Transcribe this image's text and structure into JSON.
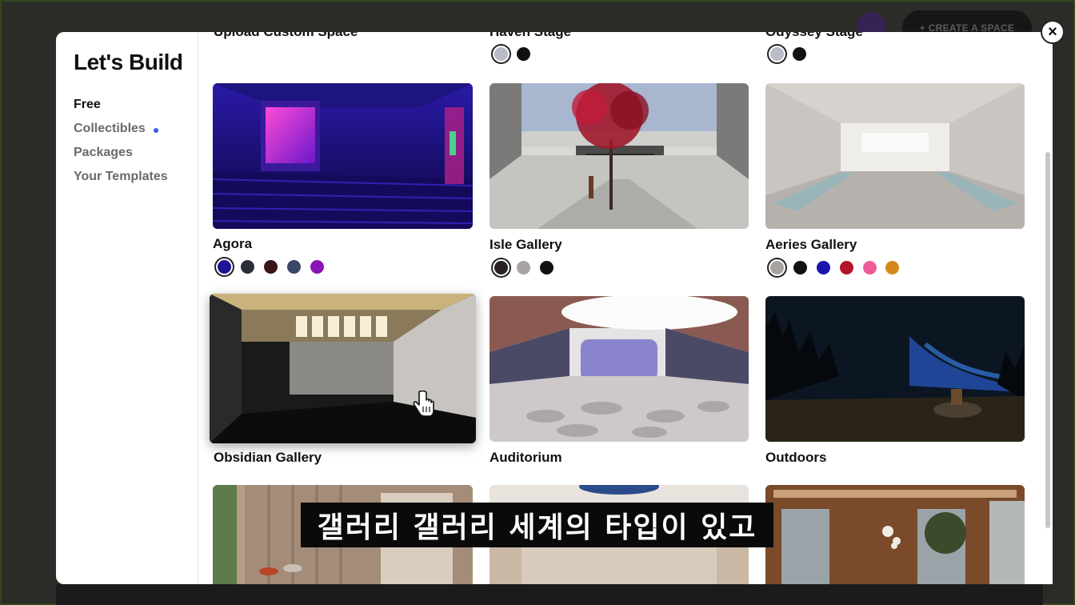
{
  "background": {
    "create_space_label": "+ CREATE A SPACE"
  },
  "modal": {
    "title": "Let's Build",
    "nav": [
      {
        "label": "Free",
        "active": true
      },
      {
        "label": "Collectibles",
        "active": false,
        "indicator": true
      },
      {
        "label": "Packages",
        "active": false
      },
      {
        "label": "Your Templates",
        "active": false
      }
    ],
    "close_label": "×"
  },
  "top_row": [
    {
      "title": "Upload Custom Space"
    },
    {
      "title": "Haven Stage",
      "swatches": [
        "#b9bcc6",
        "#111111"
      ]
    },
    {
      "title": "Odyssey Stage",
      "swatches": [
        "#b9bcc6",
        "#111111"
      ]
    }
  ],
  "cards": [
    {
      "title": "Agora",
      "swatches": [
        "#1d1494",
        "#2b2e36",
        "#3b1414",
        "#384763",
        "#8a14b8"
      ]
    },
    {
      "title": "Isle Gallery",
      "swatches": [
        "#2a2222",
        "#a8a4a6",
        "#111111"
      ]
    },
    {
      "title": "Aeries Gallery",
      "swatches": [
        "#a9a3a1",
        "#111111",
        "#1a14b0",
        "#b3142a",
        "#f05a98",
        "#d38a1a"
      ]
    },
    {
      "title": "Obsidian Gallery",
      "swatches": []
    },
    {
      "title": "Auditorium",
      "swatches": []
    },
    {
      "title": "Outdoors",
      "swatches": []
    }
  ],
  "caption": "갤러리 갤러리 세계의 타입이 있고"
}
